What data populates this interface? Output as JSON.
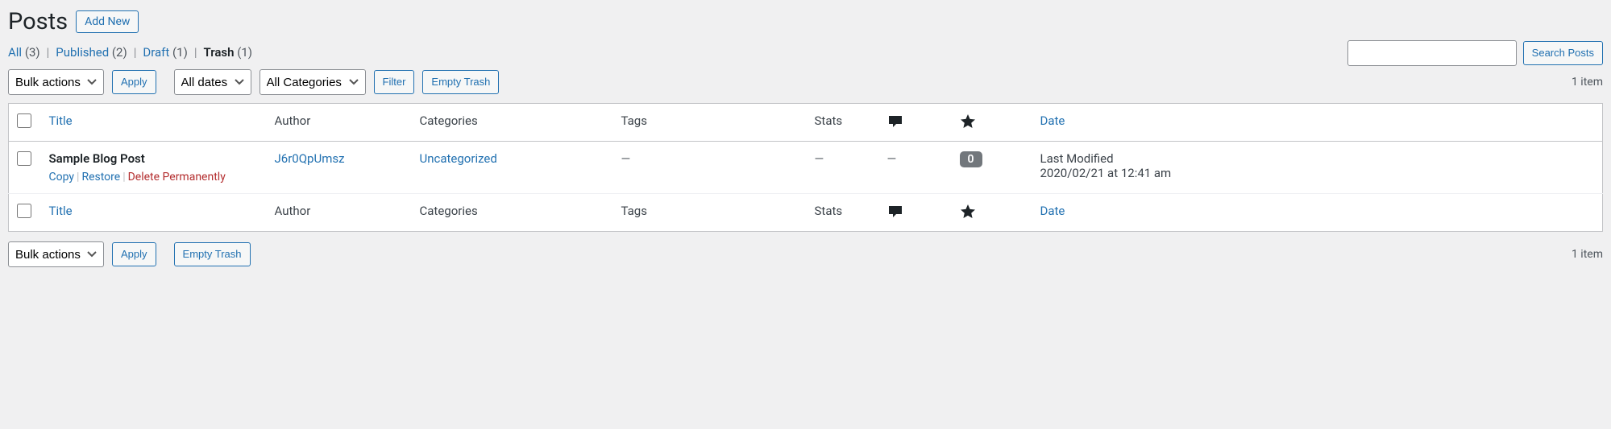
{
  "header": {
    "title": "Posts",
    "add_new": "Add New"
  },
  "status_links": {
    "all_label": "All",
    "all_count": "(3)",
    "published_label": "Published",
    "published_count": "(2)",
    "draft_label": "Draft",
    "draft_count": "(1)",
    "trash_label": "Trash",
    "trash_count": "(1)"
  },
  "search": {
    "value": "",
    "button": "Search Posts"
  },
  "filters": {
    "bulk_actions": "Bulk actions",
    "apply": "Apply",
    "all_dates": "All dates",
    "all_categories": "All Categories",
    "filter": "Filter",
    "empty_trash": "Empty Trash"
  },
  "pagination": {
    "item_count": "1 item"
  },
  "columns": {
    "title": "Title",
    "author": "Author",
    "categories": "Categories",
    "tags": "Tags",
    "stats": "Stats",
    "date": "Date"
  },
  "row": {
    "title": "Sample Blog Post",
    "author": "J6r0QpUmsz",
    "category": "Uncategorized",
    "tags": "—",
    "stats": "—",
    "comments": "—",
    "likes": "0",
    "date_line1": "Last Modified",
    "date_line2": "2020/02/21 at 12:41 am",
    "actions": {
      "copy": "Copy",
      "restore": "Restore",
      "delete": "Delete Permanently"
    }
  }
}
